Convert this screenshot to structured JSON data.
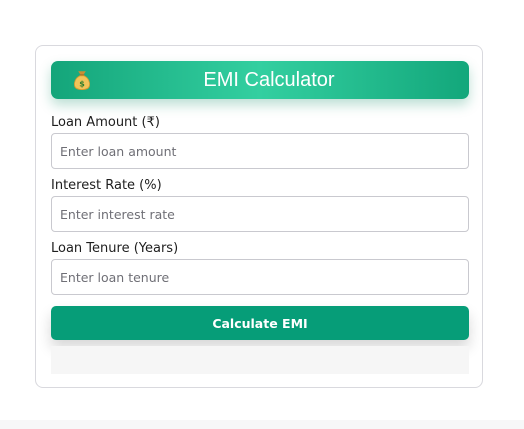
{
  "header": {
    "icon": "money-bag-icon",
    "title": "EMI Calculator",
    "gradient_start": "#14a57a",
    "gradient_mid": "#33cfa0"
  },
  "form": {
    "loan_amount": {
      "label": "Loan Amount (₹)",
      "placeholder": "Enter loan amount",
      "value": ""
    },
    "interest_rate": {
      "label": "Interest Rate (%)",
      "placeholder": "Enter interest rate",
      "value": ""
    },
    "loan_tenure": {
      "label": "Loan Tenure (Years)",
      "placeholder": "Enter loan tenure",
      "value": ""
    }
  },
  "actions": {
    "calculate_label": "Calculate EMI",
    "button_color": "#069d78"
  }
}
